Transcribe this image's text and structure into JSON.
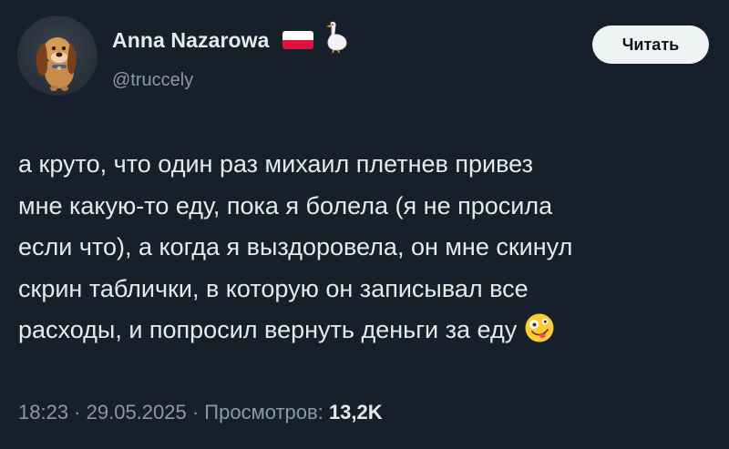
{
  "author": {
    "name": "Anna Nazarowa",
    "handle": "@truccely",
    "flag_icon": "poland-flag-icon",
    "extra_icon": "goose-icon"
  },
  "follow_button": {
    "label": "Читать"
  },
  "tweet": {
    "lines": [
      "а круто, что один раз михаил плетнев привез",
      "мне какую-то еду, пока я болела (я не просила",
      "если что), а когда я выздоровела, он мне скинул",
      "скрин таблички, в которую он записывал все",
      "расходы, и попросил вернуть деньги за еду"
    ],
    "trailing_emoji": "zany-face-emoji"
  },
  "meta": {
    "time": "18:23",
    "separator": " · ",
    "date": "29.05.2025",
    "views_label": "Просмотров:",
    "views_count": "13,2K"
  },
  "colors": {
    "background": "#15202b",
    "text": "#e7e9ea",
    "secondary_text": "#8b98a5",
    "button_bg": "#eff3f4",
    "button_text": "#0f1419"
  }
}
